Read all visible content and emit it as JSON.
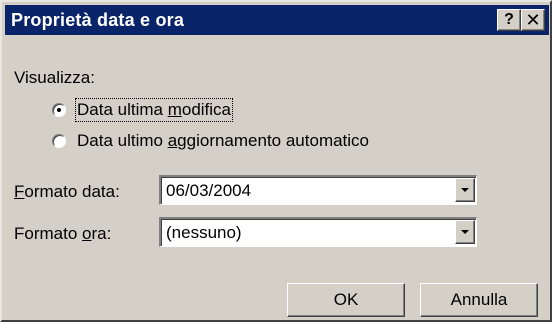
{
  "window": {
    "title": "Proprietà data e ora",
    "help_glyph": "?",
    "close_glyph": "✕"
  },
  "display": {
    "label": "Visualizza:",
    "options": [
      {
        "pre": "Data ultima ",
        "mnemonic": "m",
        "post": "odifica",
        "selected": true
      },
      {
        "pre": "Data ultimo ",
        "mnemonic": "a",
        "post": "ggiornamento automatico",
        "selected": false
      }
    ]
  },
  "date_format": {
    "mnemonic": "F",
    "label_rest": "ormato data:",
    "value": "06/03/2004"
  },
  "time_format": {
    "label_pre": "Formato ",
    "mnemonic": "o",
    "label_post": "ra:",
    "value": "(nessuno)"
  },
  "buttons": {
    "ok": "OK",
    "cancel": "Annulla"
  }
}
